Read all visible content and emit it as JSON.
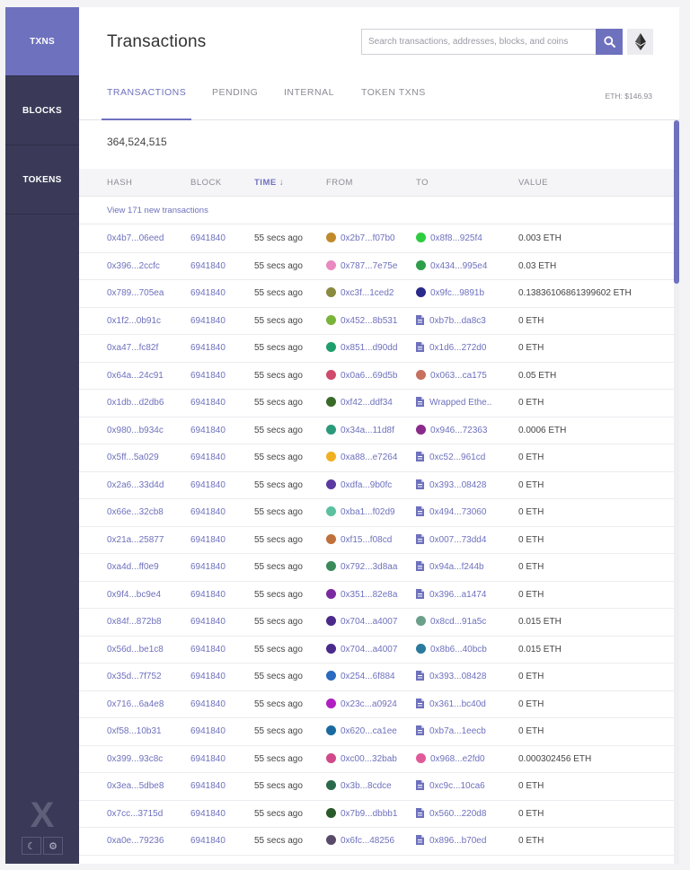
{
  "sidebar": {
    "items": [
      {
        "label": "TXNS",
        "active": true
      },
      {
        "label": "BLOCKS",
        "active": false
      },
      {
        "label": "TOKENS",
        "active": false
      }
    ],
    "logo": "X",
    "tools": [
      {
        "icon": "moon-icon",
        "glyph": "☾"
      },
      {
        "icon": "gear-icon",
        "glyph": "⚙"
      }
    ]
  },
  "header": {
    "title": "Transactions",
    "search_placeholder": "Search transactions, addresses, blocks, and coins"
  },
  "tabs": [
    {
      "label": "TRANSACTIONS",
      "active": true
    },
    {
      "label": "PENDING",
      "active": false
    },
    {
      "label": "INTERNAL",
      "active": false
    },
    {
      "label": "TOKEN TXNS",
      "active": false
    }
  ],
  "eth_price": "ETH: $146.93",
  "total_count": "364,524,515",
  "columns": {
    "hash": "HASH",
    "block": "BLOCK",
    "time": "TIME ↓",
    "from": "FROM",
    "to": "TO",
    "value": "VALUE"
  },
  "new_transactions_link": "View 171 new transactions",
  "accent_color": "#6e71bd",
  "sidebar_color": "#3a3a58",
  "transactions": [
    {
      "hash": "0x4b7...06eed",
      "block": "6941840",
      "time": "55 secs ago",
      "from": "0x2b7...f07b0",
      "from_color": "#c08a2a",
      "to": "0x8f8...925f4",
      "to_color": "#2ecc40",
      "to_contract": false,
      "value": "0.003 ETH"
    },
    {
      "hash": "0x396...2ccfc",
      "block": "6941840",
      "time": "55 secs ago",
      "from": "0x787...7e75e",
      "from_color": "#e88ac0",
      "to": "0x434...995e4",
      "to_color": "#2e9e4a",
      "to_contract": false,
      "value": "0.03 ETH"
    },
    {
      "hash": "0x789...705ea",
      "block": "6941840",
      "time": "55 secs ago",
      "from": "0xc3f...1ced2",
      "from_color": "#8a8a40",
      "to": "0x9fc...9891b",
      "to_color": "#2a2a8a",
      "to_contract": false,
      "value": "0.13836106861399602 ETH"
    },
    {
      "hash": "0x1f2...0b91c",
      "block": "6941840",
      "time": "55 secs ago",
      "from": "0x452...8b531",
      "from_color": "#7ab33a",
      "to": "0xb7b...da8c3",
      "to_color": "#6e71bd",
      "to_contract": true,
      "value": "0 ETH"
    },
    {
      "hash": "0xa47...fc82f",
      "block": "6941840",
      "time": "55 secs ago",
      "from": "0x851...d90dd",
      "from_color": "#1e9e6a",
      "to": "0x1d6...272d0",
      "to_color": "#6e71bd",
      "to_contract": true,
      "value": "0 ETH"
    },
    {
      "hash": "0x64a...24c91",
      "block": "6941840",
      "time": "55 secs ago",
      "from": "0x0a6...69d5b",
      "from_color": "#d04a6a",
      "to": "0x063...ca175",
      "to_color": "#c87060",
      "to_contract": false,
      "value": "0.05 ETH"
    },
    {
      "hash": "0x1db...d2db6",
      "block": "6941840",
      "time": "55 secs ago",
      "from": "0xf42...ddf34",
      "from_color": "#3a6a2a",
      "to": "Wrapped Ethe..",
      "to_color": "#6e71bd",
      "to_contract": true,
      "value": "0 ETH"
    },
    {
      "hash": "0x980...b934c",
      "block": "6941840",
      "time": "55 secs ago",
      "from": "0x34a...11d8f",
      "from_color": "#2a9a7a",
      "to": "0x946...72363",
      "to_color": "#8a2a8a",
      "to_contract": false,
      "value": "0.0006 ETH"
    },
    {
      "hash": "0x5ff...5a029",
      "block": "6941840",
      "time": "55 secs ago",
      "from": "0xa88...e7264",
      "from_color": "#f0b020",
      "to": "0xc52...961cd",
      "to_color": "#6e71bd",
      "to_contract": true,
      "value": "0 ETH"
    },
    {
      "hash": "0x2a6...33d4d",
      "block": "6941840",
      "time": "55 secs ago",
      "from": "0xdfa...9b0fc",
      "from_color": "#5a3aa0",
      "to": "0x393...08428",
      "to_color": "#6e71bd",
      "to_contract": true,
      "value": "0 ETH"
    },
    {
      "hash": "0x66e...32cb8",
      "block": "6941840",
      "time": "55 secs ago",
      "from": "0xba1...f02d9",
      "from_color": "#5ac0a0",
      "to": "0x494...73060",
      "to_color": "#6e71bd",
      "to_contract": true,
      "value": "0 ETH"
    },
    {
      "hash": "0x21a...25877",
      "block": "6941840",
      "time": "55 secs ago",
      "from": "0xf15...f08cd",
      "from_color": "#c0703a",
      "to": "0x007...73dd4",
      "to_color": "#6e71bd",
      "to_contract": true,
      "value": "0 ETH"
    },
    {
      "hash": "0xa4d...ff0e9",
      "block": "6941840",
      "time": "55 secs ago",
      "from": "0x792...3d8aa",
      "from_color": "#3a8a5a",
      "to": "0x94a...f244b",
      "to_color": "#6e71bd",
      "to_contract": true,
      "value": "0 ETH"
    },
    {
      "hash": "0x9f4...bc9e4",
      "block": "6941840",
      "time": "55 secs ago",
      "from": "0x351...82e8a",
      "from_color": "#7a2aa0",
      "to": "0x396...a1474",
      "to_color": "#6e71bd",
      "to_contract": true,
      "value": "0 ETH"
    },
    {
      "hash": "0x84f...872b8",
      "block": "6941840",
      "time": "55 secs ago",
      "from": "0x704...a4007",
      "from_color": "#4a2a8a",
      "to": "0x8cd...91a5c",
      "to_color": "#6aa08a",
      "to_contract": false,
      "value": "0.015 ETH"
    },
    {
      "hash": "0x56d...be1c8",
      "block": "6941840",
      "time": "55 secs ago",
      "from": "0x704...a4007",
      "from_color": "#4a2a8a",
      "to": "0x8b6...40bcb",
      "to_color": "#2a7aa0",
      "to_contract": false,
      "value": "0.015 ETH"
    },
    {
      "hash": "0x35d...7f752",
      "block": "6941840",
      "time": "55 secs ago",
      "from": "0x254...6f884",
      "from_color": "#2a6ac0",
      "to": "0x393...08428",
      "to_color": "#6e71bd",
      "to_contract": true,
      "value": "0 ETH"
    },
    {
      "hash": "0x716...6a4e8",
      "block": "6941840",
      "time": "55 secs ago",
      "from": "0x23c...a0924",
      "from_color": "#b020c0",
      "to": "0x361...bc40d",
      "to_color": "#6e71bd",
      "to_contract": true,
      "value": "0 ETH"
    },
    {
      "hash": "0xf58...10b31",
      "block": "6941840",
      "time": "55 secs ago",
      "from": "0x620...ca1ee",
      "from_color": "#1a6aa0",
      "to": "0xb7a...1eecb",
      "to_color": "#6e71bd",
      "to_contract": true,
      "value": "0 ETH"
    },
    {
      "hash": "0x399...93c8c",
      "block": "6941840",
      "time": "55 secs ago",
      "from": "0xc00...32bab",
      "from_color": "#d04a8a",
      "to": "0x968...e2fd0",
      "to_color": "#e05a9a",
      "to_contract": false,
      "value": "0.000302456 ETH"
    },
    {
      "hash": "0x3ea...5dbe8",
      "block": "6941840",
      "time": "55 secs ago",
      "from": "0x3b...8cdce",
      "from_color": "#2a6a4a",
      "to": "0xc9c...10ca6",
      "to_color": "#6e71bd",
      "to_contract": true,
      "value": "0 ETH"
    },
    {
      "hash": "0x7cc...3715d",
      "block": "6941840",
      "time": "55 secs ago",
      "from": "0x7b9...dbbb1",
      "from_color": "#2a5a2a",
      "to": "0x560...220d8",
      "to_color": "#6e71bd",
      "to_contract": true,
      "value": "0 ETH"
    },
    {
      "hash": "0xa0e...79236",
      "block": "6941840",
      "time": "55 secs ago",
      "from": "0x6fc...48256",
      "from_color": "#5a4a6a",
      "to": "0x896...b70ed",
      "to_color": "#6e71bd",
      "to_contract": true,
      "value": "0 ETH"
    }
  ]
}
